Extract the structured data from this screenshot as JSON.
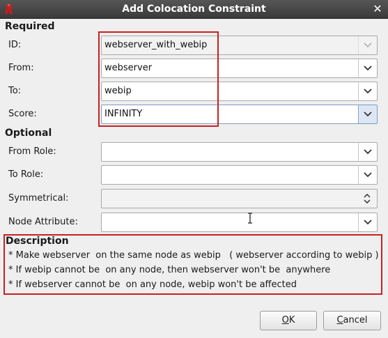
{
  "window": {
    "title": "Add Colocation Constraint",
    "close_glyph": "✕"
  },
  "required": {
    "header": "Required",
    "id": {
      "label": "ID:",
      "value": "webserver_with_webip"
    },
    "from": {
      "label": "From:",
      "value": "webserver"
    },
    "to": {
      "label": "To:",
      "value": "webip"
    },
    "score": {
      "label": "Score:",
      "value": "INFINITY"
    }
  },
  "optional": {
    "header": "Optional",
    "from_role": {
      "label": "From Role:",
      "value": ""
    },
    "to_role": {
      "label": "To Role:",
      "value": ""
    },
    "symmetrical": {
      "label": "Symmetrical:",
      "value": ""
    },
    "node_attribute": {
      "label": "Node Attribute:",
      "value": ""
    }
  },
  "description": {
    "header": "Description",
    "lines": [
      "* Make webserver  on the same node as webip   ( webserver according to webip )",
      "* If webip cannot be  on any node, then webserver won't be  anywhere",
      "* If webserver cannot be  on any node, webip won't be affected"
    ]
  },
  "buttons": {
    "ok": {
      "mnemonic": "O",
      "rest": "K"
    },
    "cancel": {
      "mnemonic": "C",
      "rest": "ancel"
    }
  },
  "icons": {
    "app": "app-logo-icon",
    "dropdown": "chevron-down-icon",
    "spinner": "up-down-arrows-icon"
  },
  "colors": {
    "highlight": "#c82020",
    "titlebar": "#4a4a4a"
  }
}
